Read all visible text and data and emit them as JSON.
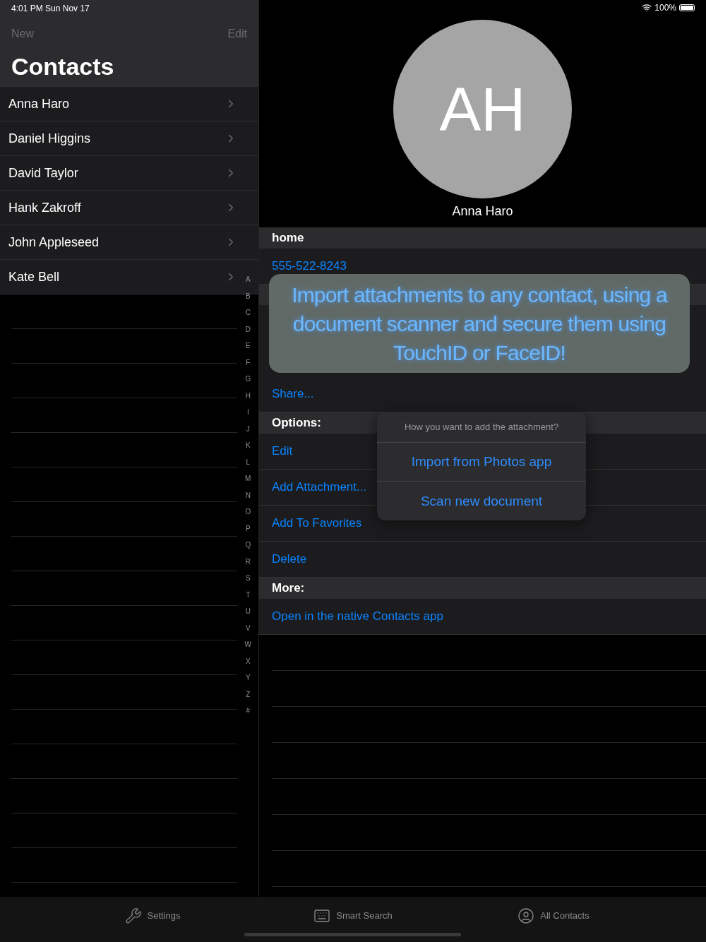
{
  "status_bar": {
    "time": "4:01 PM",
    "date": "Sun Nov 17",
    "battery": "100%"
  },
  "sidebar": {
    "left_button": "New",
    "right_button": "Edit",
    "title": "Contacts",
    "contacts": [
      {
        "name": "Anna Haro"
      },
      {
        "name": "Daniel Higgins"
      },
      {
        "name": "David Taylor"
      },
      {
        "name": "Hank Zakroff"
      },
      {
        "name": "John Appleseed"
      },
      {
        "name": "Kate Bell"
      }
    ],
    "index_letters": [
      "A",
      "B",
      "C",
      "D",
      "E",
      "F",
      "G",
      "H",
      "I",
      "J",
      "K",
      "L",
      "M",
      "N",
      "O",
      "P",
      "Q",
      "R",
      "S",
      "T",
      "U",
      "V",
      "W",
      "X",
      "Y",
      "Z",
      "#"
    ]
  },
  "detail": {
    "initials": "AH",
    "name": "Anna Haro",
    "sections": [
      {
        "header": "home",
        "rows": [
          "555-522-8243"
        ]
      },
      {
        "header": "Options:",
        "rows": [
          "Edit",
          "Add Attachment...",
          "Add To Favorites",
          "Delete"
        ]
      },
      {
        "header": "More:",
        "rows": [
          "Open in the native Contacts app"
        ]
      }
    ],
    "share": "Share..."
  },
  "banner": {
    "text": "Import attachments to any contact, using a document scanner and secure them using TouchID or FaceID!"
  },
  "action_sheet": {
    "title": "How you want to add the attachment?",
    "actions": [
      "Import from Photos app",
      "Scan new document"
    ]
  },
  "tab_bar": [
    {
      "label": "Settings",
      "kind": "wrench"
    },
    {
      "label": "Smart Search",
      "kind": "keyboard"
    },
    {
      "label": "All Contacts",
      "kind": "person"
    }
  ]
}
